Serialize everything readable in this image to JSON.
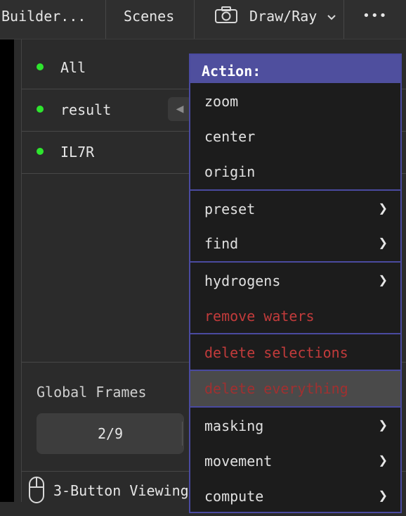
{
  "topbar": {
    "builder_label": "Builder...",
    "scenes_label": "Scenes",
    "draw_label": "Draw/Ray",
    "more_label": "•••"
  },
  "objects": [
    {
      "name": "All",
      "enabled": true
    },
    {
      "name": "result",
      "enabled": true
    },
    {
      "name": "IL7R",
      "enabled": true
    }
  ],
  "frames": {
    "label": "Global Frames",
    "value": "2/9"
  },
  "status": {
    "label": "3-Button Viewing"
  },
  "action_menu": {
    "title": "Action:",
    "items": [
      {
        "label": "zoom",
        "submenu": false
      },
      {
        "label": "center",
        "submenu": false
      },
      {
        "label": "origin",
        "submenu": false
      },
      {
        "label": "preset",
        "submenu": true
      },
      {
        "label": "find",
        "submenu": true
      },
      {
        "label": "hydrogens",
        "submenu": true
      },
      {
        "label": "remove waters",
        "submenu": false
      },
      {
        "label": "delete selections",
        "submenu": false
      },
      {
        "label": "delete everything",
        "submenu": false
      },
      {
        "label": "masking",
        "submenu": true
      },
      {
        "label": "movement",
        "submenu": true
      },
      {
        "label": "compute",
        "submenu": true
      }
    ]
  },
  "colors": {
    "accent": "#4f4f9e",
    "danger": "#c23b3b",
    "enabled_dot": "#2ee52e"
  }
}
